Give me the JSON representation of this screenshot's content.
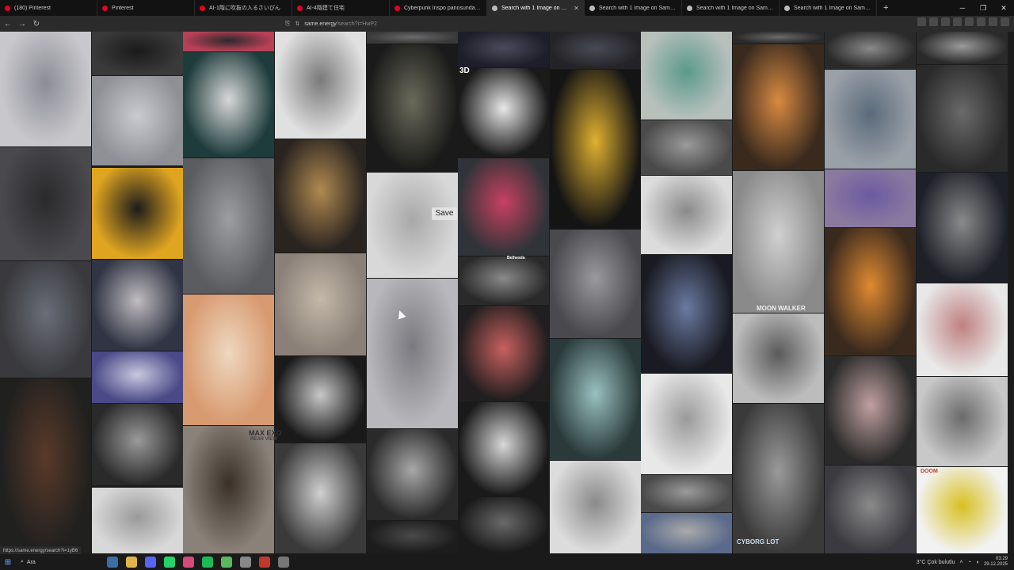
{
  "browser": {
    "tabs": [
      {
        "title": "(180) Pinterest",
        "fav": "#e60023",
        "active": false
      },
      {
        "title": "Pinterest",
        "fav": "#e60023",
        "active": false
      },
      {
        "title": "AI-1階に吹抜の入るさいぴん",
        "fav": "#e60023",
        "active": false
      },
      {
        "title": "AI-4階建て住宅",
        "fav": "#e60023",
        "active": false
      },
      {
        "title": "Cyberpunk İnspo panosundaki Pin",
        "fav": "#e60023",
        "active": false
      },
      {
        "title": "Search with 1 Image on Same En",
        "fav": "#bbbbbb",
        "active": true
      },
      {
        "title": "Search with 1 Image on Same Energy",
        "fav": "#bbbbbb",
        "active": false
      },
      {
        "title": "Search with 1 Image on Same Energy",
        "fav": "#bbbbbb",
        "active": false
      },
      {
        "title": "Search with 1 Image on Same Energy",
        "fav": "#bbbbbb",
        "active": false
      }
    ],
    "new_tab": "+",
    "url_domain": "same.energy",
    "url_path": "/search?i=HwP2",
    "status_url": "https://same.energy/search?i=1yB6"
  },
  "page": {
    "save_label": "Save",
    "tile_texts": {
      "d3": "3D",
      "moonwalker": "MOON WALKER",
      "maxexo": "MAX EXO",
      "rearview": "REAR VIEW",
      "bethesda": "Bethesda",
      "doom": "DOOM",
      "cyborg": "CYBORG LOT"
    }
  },
  "taskbar": {
    "search_placeholder": "Ara",
    "weather": "3°C  Çok bulutlu",
    "time": "03:29",
    "date": "29.12.2025"
  }
}
